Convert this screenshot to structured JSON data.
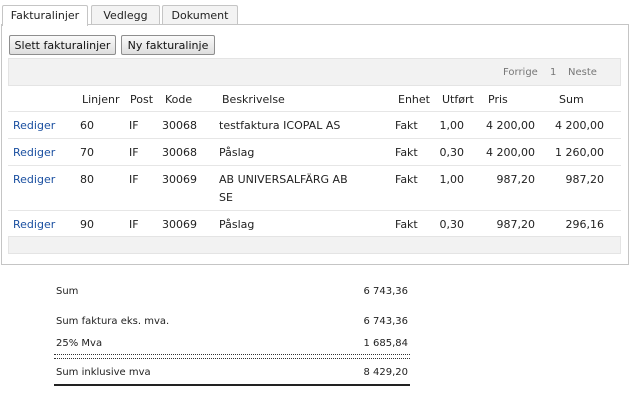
{
  "tabs": [
    {
      "label": "Fakturalinjer"
    },
    {
      "label": "Vedlegg"
    },
    {
      "label": "Dokument"
    }
  ],
  "toolbar": {
    "delete_label": "Slett fakturalinjer",
    "new_label": "Ny fakturalinje"
  },
  "pager": {
    "prev": "Forrige",
    "page": "1",
    "next": "Neste"
  },
  "table": {
    "headers": {
      "linjenr": "Linjenr",
      "post": "Post",
      "kode": "Kode",
      "beskrivelse": "Beskrivelse",
      "enhet": "Enhet",
      "utfort": "Utført",
      "pris": "Pris",
      "sum": "Sum"
    },
    "rows": [
      {
        "action": "Rediger",
        "linjenr": "60",
        "post": "IF",
        "kode": "30068",
        "beskrivelse": "testfaktura ICOPAL AS",
        "beskrivelse2": "",
        "enhet": "Fakt",
        "utfort": "1,00",
        "pris": "4 200,00",
        "sum": "4 200,00"
      },
      {
        "action": "Rediger",
        "linjenr": "70",
        "post": "IF",
        "kode": "30068",
        "beskrivelse": "Påslag",
        "beskrivelse2": "",
        "enhet": "Fakt",
        "utfort": "0,30",
        "pris": "4 200,00",
        "sum": "1 260,00"
      },
      {
        "action": "Rediger",
        "linjenr": "80",
        "post": "IF",
        "kode": "30069",
        "beskrivelse": "AB UNIVERSALFÄRG AB",
        "beskrivelse2": "SE",
        "enhet": "Fakt",
        "utfort": "1,00",
        "pris": "987,20",
        "sum": "987,20"
      },
      {
        "action": "Rediger",
        "linjenr": "90",
        "post": "IF",
        "kode": "30069",
        "beskrivelse": "Påslag",
        "beskrivelse2": "",
        "enhet": "Fakt",
        "utfort": "0,30",
        "pris": "987,20",
        "sum": "296,16"
      }
    ]
  },
  "summary": {
    "sum_label": "Sum",
    "sum_value": "6 743,36",
    "ex_mva_label": "Sum faktura eks. mva.",
    "ex_mva_value": "6 743,36",
    "mva_label": "25% Mva",
    "mva_value": "1 685,84",
    "inkl_label": "Sum inklusive mva",
    "inkl_value": "8 429,20"
  }
}
